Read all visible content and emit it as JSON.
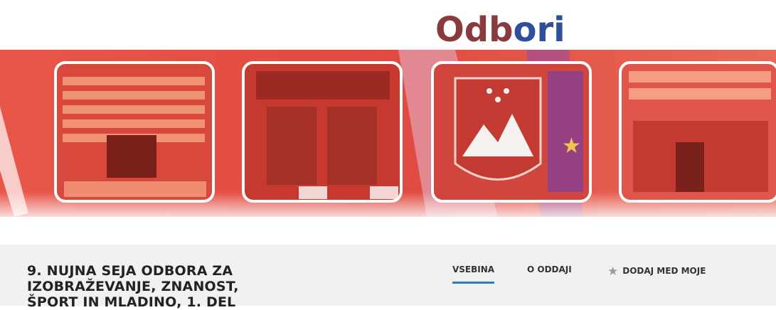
{
  "logo": {
    "parts": [
      "Od",
      "b",
      "ori"
    ],
    "colors": [
      "#8a3a3a",
      "#8a3a3a",
      "#2d4f9e"
    ]
  },
  "colors": {
    "banner_red": "#e34a3c",
    "accent_blue": "#2b7cc9",
    "info_bar_bg": "#f1f1f1"
  },
  "show": {
    "title": "9. NUJNA SEJA ODBORA ZA IZOBRAŽEVANJE, ZNANOST, ŠPORT IN MLADINO, 1. DEL"
  },
  "tabs": [
    {
      "label": "VSEBINA",
      "active": true
    },
    {
      "label": "O ODDAJI",
      "active": false
    },
    {
      "label": "DODAJ MED MOJE",
      "icon": "star-icon",
      "active": false
    }
  ]
}
